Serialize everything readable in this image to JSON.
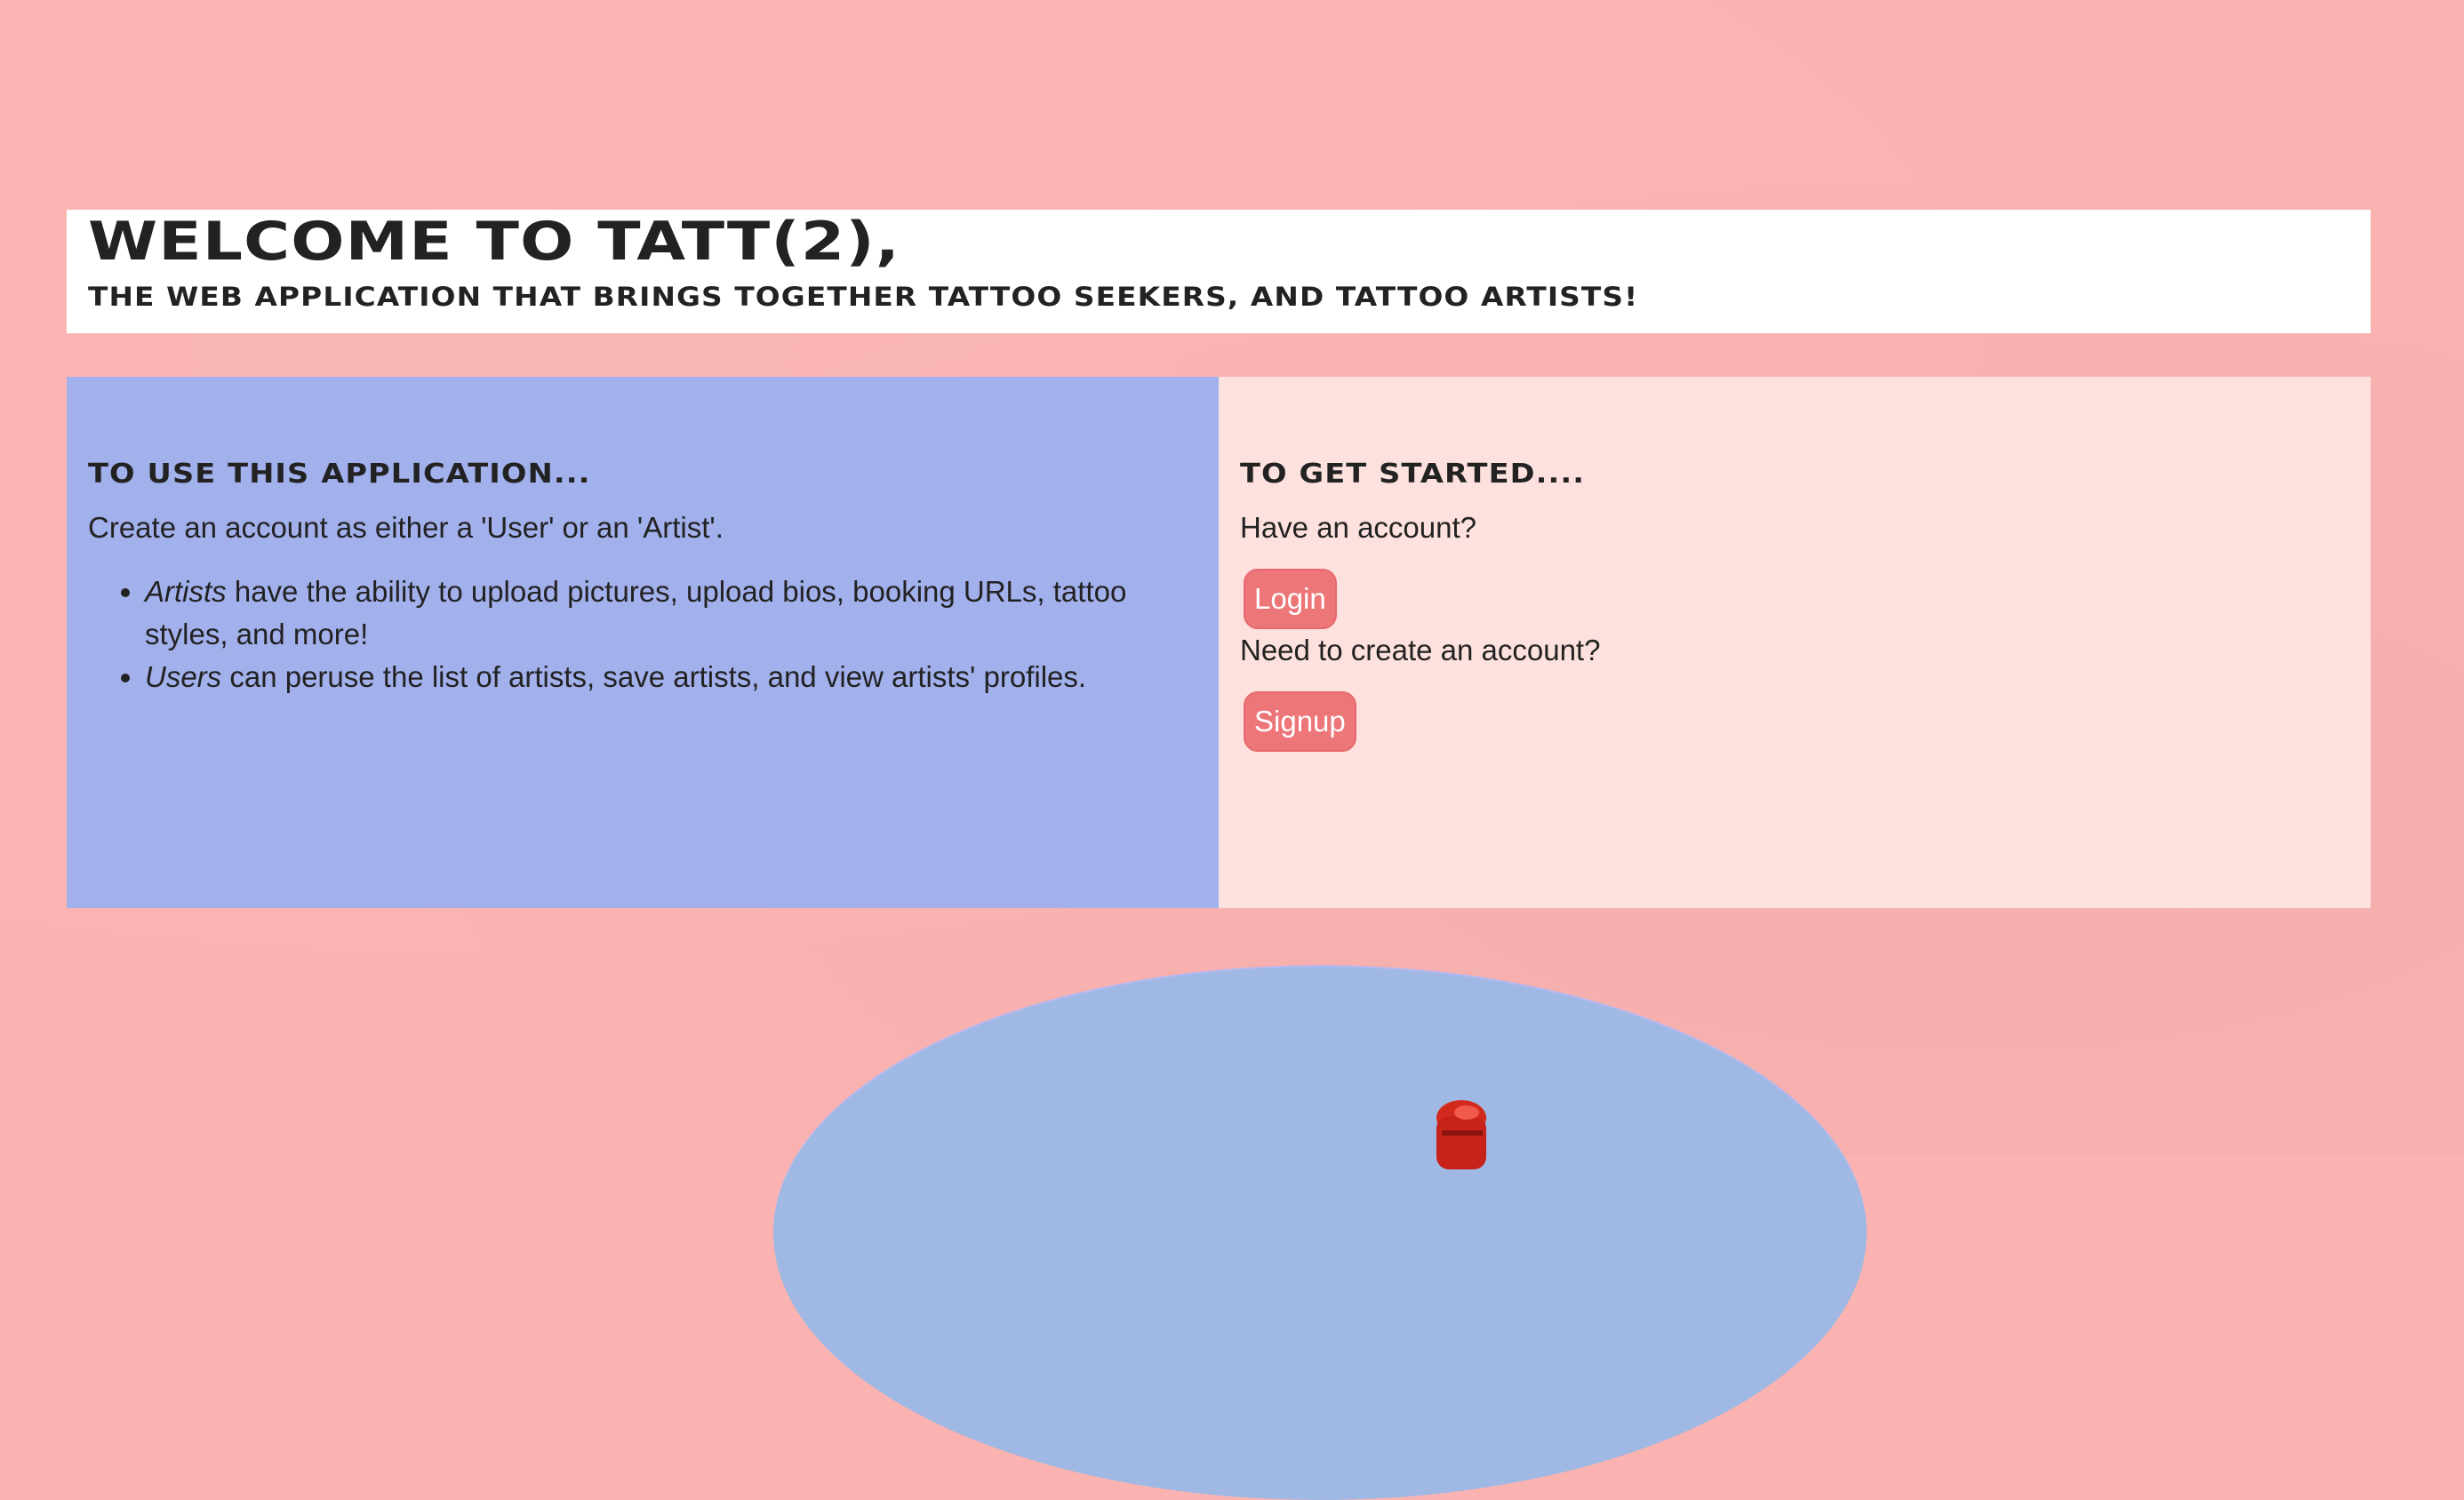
{
  "header": {
    "title": "WELCOME TO TATT(2),",
    "subtitle": "THE WEB APPLICATION THAT BRINGS TOGETHER TATTOO SEEKERS, AND TATTOO ARTISTS!"
  },
  "left_panel": {
    "heading": "TO USE THIS APPLICATION...",
    "intro": "Create an account as either a 'User' or an 'Artist'.",
    "items": [
      {
        "em": "Artists",
        "text": " have the ability to upload pictures, upload bios, booking URLs, tattoo styles, and more!"
      },
      {
        "em": "Users",
        "text": " can peruse the list of artists, save artists, and view artists' profiles."
      }
    ]
  },
  "right_panel": {
    "heading": "TO GET STARTED....",
    "have_account": "Have an account?",
    "login_label": "Login",
    "need_account": "Need to create an account?",
    "signup_label": "Signup"
  },
  "colors": {
    "background": "#fbb3b1",
    "left_panel": "#a2b0ec",
    "right_panel": "#fde1de",
    "button": "#ed7679",
    "disc": "#a0b8e4"
  }
}
